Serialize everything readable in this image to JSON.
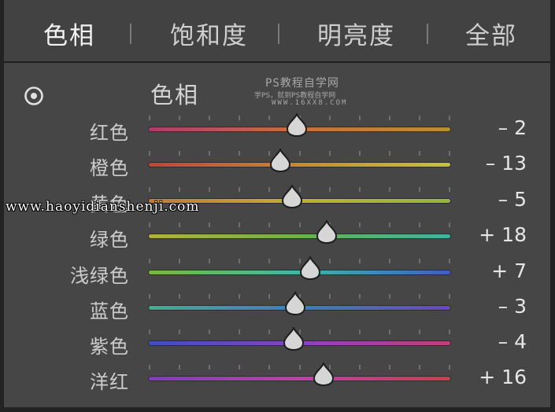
{
  "tabs": [
    {
      "label": "色相",
      "active": true
    },
    {
      "label": "饱和度",
      "active": false
    },
    {
      "label": "明亮度",
      "active": false
    },
    {
      "label": "全部",
      "active": false
    }
  ],
  "section_title": "色相",
  "target_icon": "target-adjustment-icon",
  "watermarks": {
    "top_line1": "PS教程自学网",
    "top_line2": "学PS，就到PS教程自学网",
    "top_line3": "WWW.16XX8.COM",
    "overlay": "www.haoyidianshenji.com"
  },
  "range": {
    "min": -100,
    "max": 100
  },
  "sliders": [
    {
      "label": "红色",
      "value": -2,
      "display": "– 2",
      "colors": [
        "#b03a6c",
        "#c5703e",
        "#b9902e"
      ]
    },
    {
      "label": "橙色",
      "value": -13,
      "display": "– 13",
      "colors": [
        "#c0443a",
        "#c9892e",
        "#c4c43a"
      ]
    },
    {
      "label": "黄色",
      "value": -5,
      "display": "– 5",
      "colors": [
        "#c47a30",
        "#bcb236",
        "#95b63a"
      ]
    },
    {
      "label": "绿色",
      "value": 18,
      "display": "+ 18",
      "colors": [
        "#b2b23a",
        "#6cb04a",
        "#3fb3a2"
      ]
    },
    {
      "label": "浅绿色",
      "value": 7,
      "display": "+ 7",
      "colors": [
        "#7cb83a",
        "#3fb7a8",
        "#3f5ec0"
      ]
    },
    {
      "label": "蓝色",
      "value": -3,
      "display": "– 3",
      "colors": [
        "#3cb08e",
        "#3f7cbf",
        "#6a46c2"
      ]
    },
    {
      "label": "紫色",
      "value": -4,
      "display": "– 4",
      "colors": [
        "#3d4fc0",
        "#8a42bf",
        "#c0407a"
      ]
    },
    {
      "label": "洋红",
      "value": 16,
      "display": "+ 16",
      "colors": [
        "#7d3cc0",
        "#bf3fa7",
        "#c73e4d"
      ]
    }
  ]
}
